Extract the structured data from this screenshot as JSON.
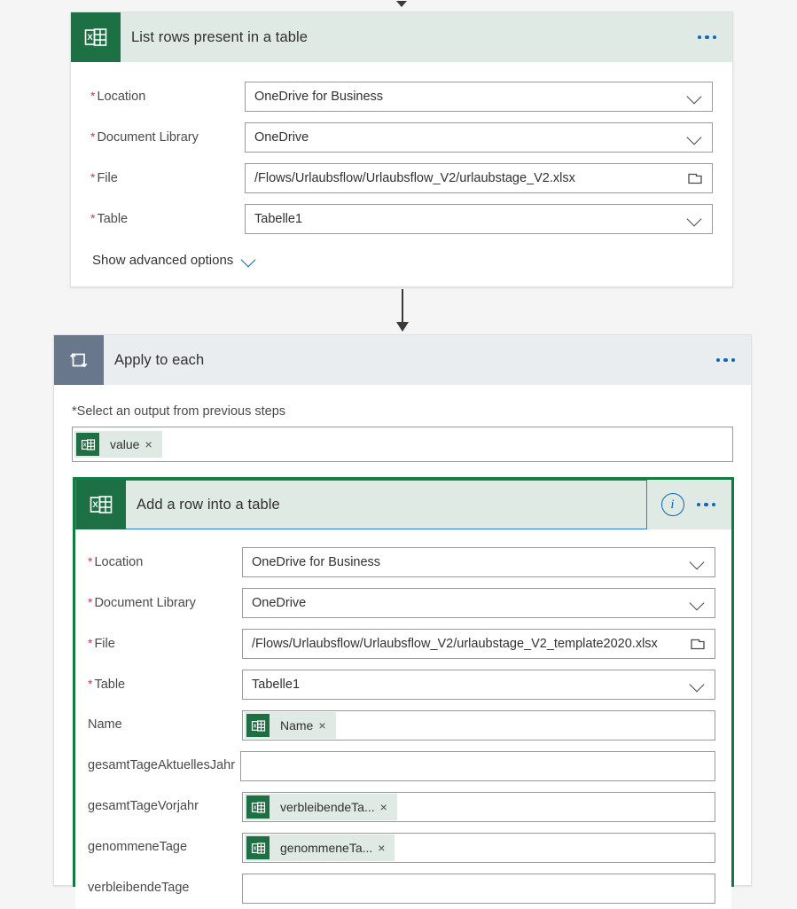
{
  "app": {
    "canvas_background": "#f5f5f5",
    "excel_green": "#1d7044",
    "excel_header_bg": "#dfeae4",
    "loop_header_bg": "#e9edf0",
    "loop_icon_bg": "#68778c",
    "accent_blue": "#1266b5",
    "selection_blue": "#2b7cd3",
    "selected_card_border": "#107c41",
    "required_asterisk_color": "#b4405f"
  },
  "steps": [
    {
      "id": "list_rows",
      "title": "List rows present in a table",
      "icon": "excel-icon",
      "menu": "more-options",
      "fields": [
        {
          "label": "Location",
          "required": true,
          "value": "OneDrive for Business",
          "control": "dropdown"
        },
        {
          "label": "Document Library",
          "required": true,
          "value": "OneDrive",
          "control": "dropdown"
        },
        {
          "label": "File",
          "required": true,
          "value": "/Flows/Urlaubsflow/Urlaubsflow_V2/urlaubstage_V2.xlsx",
          "control": "file-picker"
        },
        {
          "label": "Table",
          "required": true,
          "value": "Tabelle1",
          "control": "dropdown"
        }
      ],
      "advanced_label": "Show advanced options"
    },
    {
      "id": "apply_to_each",
      "title": "Apply to each",
      "icon": "loop-icon",
      "menu": "more-options",
      "output_label": "Select an output from previous steps",
      "output_required": true,
      "output_token": {
        "text": "value",
        "icon": "excel-icon",
        "remove": "×"
      }
    },
    {
      "id": "add_row",
      "title": "Add a row into a table",
      "icon": "excel-icon",
      "info": "i",
      "menu": "more-options",
      "selected": true,
      "fields": [
        {
          "label": "Location",
          "required": true,
          "value": "OneDrive for Business",
          "control": "dropdown"
        },
        {
          "label": "Document Library",
          "required": true,
          "value": "OneDrive",
          "control": "dropdown"
        },
        {
          "label": "File",
          "required": true,
          "value": "/Flows/Urlaubsflow/Urlaubsflow_V2/urlaubstage_V2_template2020.xlsx",
          "control": "file-picker"
        },
        {
          "label": "Table",
          "required": true,
          "value": "Tabelle1",
          "control": "dropdown"
        },
        {
          "label": "Name",
          "required": false,
          "control": "token",
          "token": {
            "text": "Name",
            "icon": "excel-icon",
            "remove": "×"
          }
        },
        {
          "label": "gesamtTageAktuellesJahr",
          "required": false,
          "control": "text",
          "value": ""
        },
        {
          "label": "gesamtTageVorjahr",
          "required": false,
          "control": "token",
          "token": {
            "text": "verbleibendeTa...",
            "icon": "excel-icon",
            "remove": "×"
          }
        },
        {
          "label": "genommeneTage",
          "required": false,
          "control": "token",
          "token": {
            "text": "genommeneTa...",
            "icon": "excel-icon",
            "remove": "×"
          }
        },
        {
          "label": "verbleibendeTage",
          "required": false,
          "control": "text",
          "value": ""
        }
      ]
    }
  ]
}
